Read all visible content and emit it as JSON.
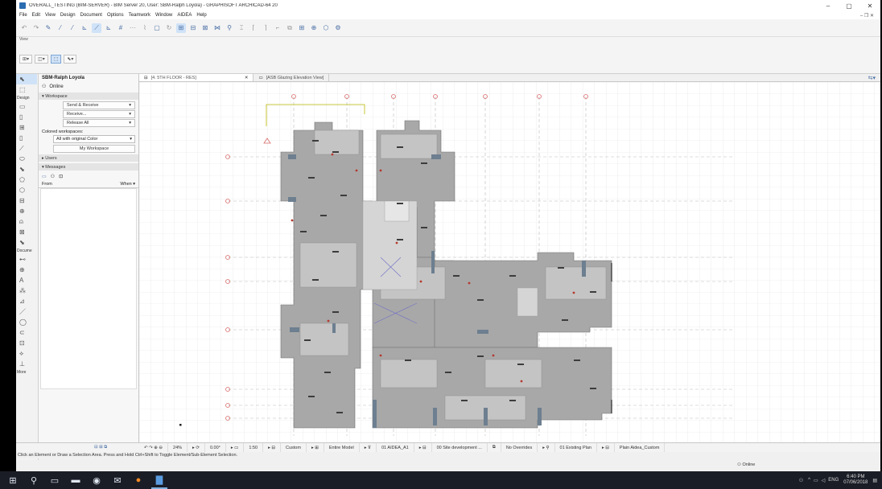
{
  "window": {
    "title": "OVERALL_TESTING (BIM-SERVER) - BIM Server 20, User: SBM-Ralph Loyola) - GRAPHISOFT ARCHICAD-64 20",
    "minimize": "–",
    "maximize": "▢",
    "close": "✕"
  },
  "menu": [
    "File",
    "Edit",
    "View",
    "Design",
    "Document",
    "Options",
    "Teamwork",
    "Window",
    "AIDEA",
    "Help"
  ],
  "menu_right": "– ❐ ✕",
  "view_label": "View",
  "toolbox": {
    "design_label": "Design",
    "document_label": "Docume",
    "more_label": "More"
  },
  "panel": {
    "user": "SBM-Ralph Loyola",
    "status": "Online",
    "workspace_header": "Workspace",
    "send_receive": "Send & Receive",
    "receive": "Receive...",
    "release_all": "Release All",
    "colored_label": "Colored workspaces:",
    "color_select": "All with original Color",
    "my_workspace": "My Workspace",
    "users_header": "Users",
    "messages_header": "Messages",
    "from_col": "From",
    "when_col": "When ▾"
  },
  "tabs": [
    {
      "label": "[4. 5TH FLOOR - RES]",
      "active": true
    },
    {
      "label": "[ASB Glazing Elevation View]",
      "active": false
    }
  ],
  "status": {
    "zoom": "24%",
    "angle": "0.00°",
    "scale": "1:50",
    "custom": "Custom",
    "model": "Entire Model",
    "layer": "01 AIDEA_A1",
    "set": "00 Site development ...",
    "overrides": "No Overrides",
    "renovation": "01 Existing Plan",
    "penset": "Plain Aidea_Custom"
  },
  "hint": "Click an Element or Draw a Selection Area. Press and Hold Ctrl+Shift to Toggle Element/Sub-Element Selection.",
  "online_status": "Online",
  "taskbar": {
    "time": "6:40 PM",
    "date": "07/06/2018",
    "lang": "ENG"
  }
}
